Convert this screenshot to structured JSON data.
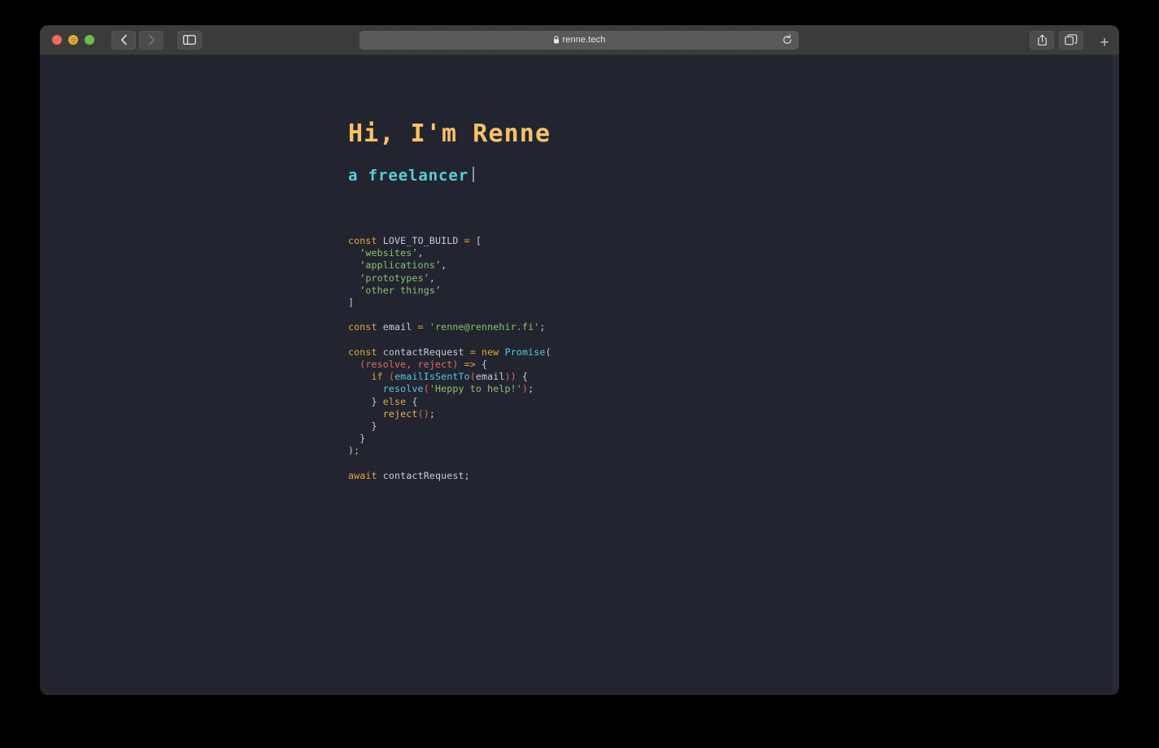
{
  "browser": {
    "traffic_lights": [
      "close",
      "minimize",
      "zoom"
    ],
    "back_label": "Back",
    "forward_label": "Forward",
    "sidebar_label": "Show Sidebar",
    "address": {
      "url": "renne.tech",
      "secure_icon": "lock-icon",
      "reload_icon": "reload-icon"
    },
    "share_label": "Share",
    "tab_overview_label": "Tab Overview",
    "new_tab_label": "+"
  },
  "page": {
    "title": "Hi, I'm Renne",
    "subtitle": "a freelancer",
    "cursor": "|",
    "code": {
      "lines": [
        [
          {
            "t": "const",
            "c": "t-kw"
          },
          {
            "t": " LOVE_TO_BUILD ",
            "c": "t-var"
          },
          {
            "t": "=",
            "c": "t-op"
          },
          {
            "t": " [",
            "c": "t-punc"
          }
        ],
        [
          {
            "t": "  ",
            "c": "t-punc"
          },
          {
            "t": "‘websites’",
            "c": "t-str"
          },
          {
            "t": ",",
            "c": "t-punc"
          }
        ],
        [
          {
            "t": "  ",
            "c": "t-punc"
          },
          {
            "t": "‘applications’",
            "c": "t-str"
          },
          {
            "t": ",",
            "c": "t-punc"
          }
        ],
        [
          {
            "t": "  ",
            "c": "t-punc"
          },
          {
            "t": "‘prototypes’",
            "c": "t-str"
          },
          {
            "t": ",",
            "c": "t-punc"
          }
        ],
        [
          {
            "t": "  ",
            "c": "t-punc"
          },
          {
            "t": "‘other things’",
            "c": "t-str"
          }
        ],
        [
          {
            "t": "]",
            "c": "t-punc"
          }
        ],
        [],
        [
          {
            "t": "const",
            "c": "t-kw"
          },
          {
            "t": " email ",
            "c": "t-var"
          },
          {
            "t": "=",
            "c": "t-op"
          },
          {
            "t": " ",
            "c": "t-punc"
          },
          {
            "t": "'renne@rennehir.fi'",
            "c": "t-str"
          },
          {
            "t": ";",
            "c": "t-punc"
          }
        ],
        [],
        [
          {
            "t": "const",
            "c": "t-kw"
          },
          {
            "t": " contactRequest ",
            "c": "t-var"
          },
          {
            "t": "=",
            "c": "t-op"
          },
          {
            "t": " ",
            "c": "t-punc"
          },
          {
            "t": "new",
            "c": "t-kw"
          },
          {
            "t": " ",
            "c": "t-punc"
          },
          {
            "t": "Promise",
            "c": "t-fn"
          },
          {
            "t": "(",
            "c": "t-punc"
          }
        ],
        [
          {
            "t": "  ",
            "c": "t-punc"
          },
          {
            "t": "(resolve, reject)",
            "c": "t-param"
          },
          {
            "t": " ",
            "c": "t-punc"
          },
          {
            "t": "=>",
            "c": "t-op"
          },
          {
            "t": " {",
            "c": "t-punc"
          }
        ],
        [
          {
            "t": "    ",
            "c": "t-punc"
          },
          {
            "t": "if",
            "c": "t-kw"
          },
          {
            "t": " ",
            "c": "t-punc"
          },
          {
            "t": "(",
            "c": "t-param"
          },
          {
            "t": "emailIsSentTo",
            "c": "t-fn"
          },
          {
            "t": "(",
            "c": "t-param"
          },
          {
            "t": "email",
            "c": "t-var"
          },
          {
            "t": "))",
            "c": "t-param"
          },
          {
            "t": " {",
            "c": "t-punc"
          }
        ],
        [
          {
            "t": "      ",
            "c": "t-punc"
          },
          {
            "t": "resolve",
            "c": "t-fn"
          },
          {
            "t": "(",
            "c": "t-param"
          },
          {
            "t": "'Heppy to help!'",
            "c": "t-str"
          },
          {
            "t": ")",
            "c": "t-param"
          },
          {
            "t": ";",
            "c": "t-punc"
          }
        ],
        [
          {
            "t": "    } ",
            "c": "t-punc"
          },
          {
            "t": "else",
            "c": "t-kw"
          },
          {
            "t": " {",
            "c": "t-punc"
          }
        ],
        [
          {
            "t": "      ",
            "c": "t-punc"
          },
          {
            "t": "reject",
            "c": "t-amber"
          },
          {
            "t": "()",
            "c": "t-param"
          },
          {
            "t": ";",
            "c": "t-punc"
          }
        ],
        [
          {
            "t": "    }",
            "c": "t-punc"
          }
        ],
        [
          {
            "t": "  }",
            "c": "t-punc"
          }
        ],
        [
          {
            "t": ")",
            "c": "t-punc"
          },
          {
            "t": ";",
            "c": "t-amber"
          }
        ],
        [],
        [
          {
            "t": "await",
            "c": "t-kw"
          },
          {
            "t": " contactRequest;",
            "c": "t-var"
          }
        ]
      ]
    }
  },
  "colors": {
    "page_background": "#222530",
    "toolbar": "#3b3b3a",
    "title": "#f7c265",
    "subtitle": "#59cfdc",
    "string": "#8fc06a",
    "keyword": "#e8a33d",
    "function": "#56c8d8",
    "param": "#e06a5f",
    "identifier": "#c9ccd4"
  }
}
